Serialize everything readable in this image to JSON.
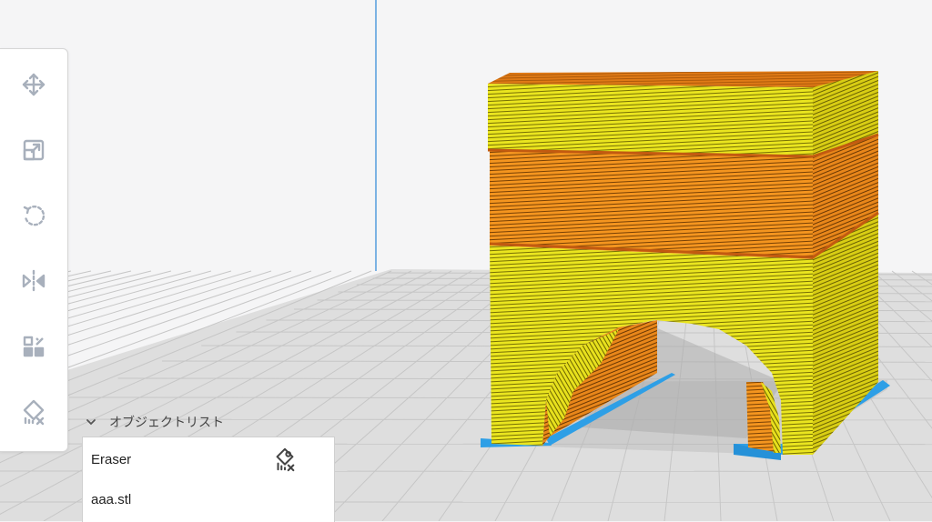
{
  "toolbar": {
    "tools": [
      {
        "icon": "move-icon",
        "label": "Move"
      },
      {
        "icon": "scale-icon",
        "label": "Scale"
      },
      {
        "icon": "rotate-icon",
        "label": "Rotate"
      },
      {
        "icon": "mirror-icon",
        "label": "Mirror"
      },
      {
        "icon": "per-model-settings-icon",
        "label": "Per Model Settings"
      },
      {
        "icon": "support-blocker-icon",
        "label": "Support Blocker"
      }
    ]
  },
  "object_list": {
    "title": "オブジェクトリスト",
    "items": [
      {
        "name": "Eraser",
        "icon": "support-blocker-icon"
      },
      {
        "name": "aaa.stl"
      }
    ]
  },
  "colors": {
    "model_yellow": "#e6e21c",
    "model_orange": "#f0901c",
    "support_blue": "#2e9fe6",
    "build_plate": "#dcdcdc",
    "grid_line": "#c4c4c4"
  }
}
